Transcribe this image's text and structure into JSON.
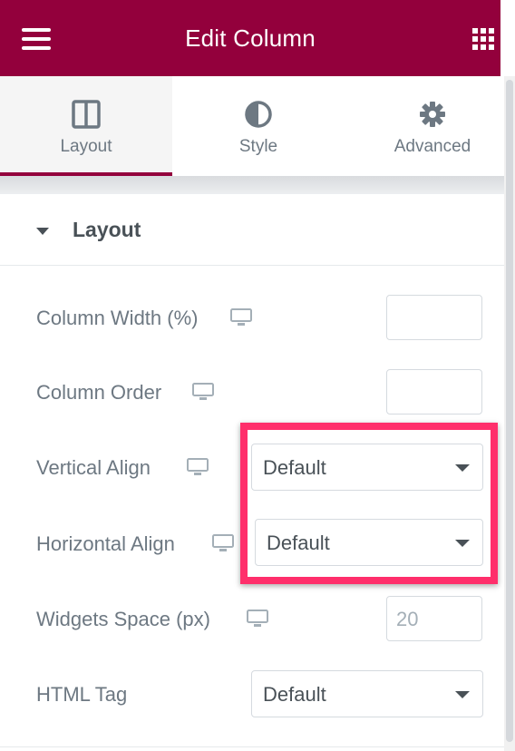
{
  "header": {
    "title": "Edit Column",
    "menu_icon": "hamburger-menu-icon",
    "apps_icon": "widgets-grid-icon",
    "color": "#93003c"
  },
  "tabs": [
    {
      "label": "Layout",
      "icon": "columns-layout-icon",
      "active": true
    },
    {
      "label": "Style",
      "icon": "half-circle-contrast-icon",
      "active": false
    },
    {
      "label": "Advanced",
      "icon": "gear-icon",
      "active": false
    }
  ],
  "section": {
    "title": "Layout",
    "expanded": true
  },
  "controls": {
    "column_width": {
      "label": "Column Width (%)",
      "value": "",
      "device_icon": "desktop-monitor-icon"
    },
    "column_order": {
      "label": "Column Order",
      "value": "",
      "device_icon": "desktop-monitor-icon"
    },
    "vertical_align": {
      "label": "Vertical Align",
      "value": "Default",
      "device_icon": "desktop-monitor-icon"
    },
    "horizontal_align": {
      "label": "Horizontal Align",
      "value": "Default",
      "device_icon": "desktop-monitor-icon"
    },
    "widgets_space": {
      "label": "Widgets Space (px)",
      "placeholder": "20",
      "device_icon": "desktop-monitor-icon"
    },
    "html_tag": {
      "label": "HTML Tag",
      "value": "Default"
    }
  },
  "highlight_color": "#ff2f6b"
}
